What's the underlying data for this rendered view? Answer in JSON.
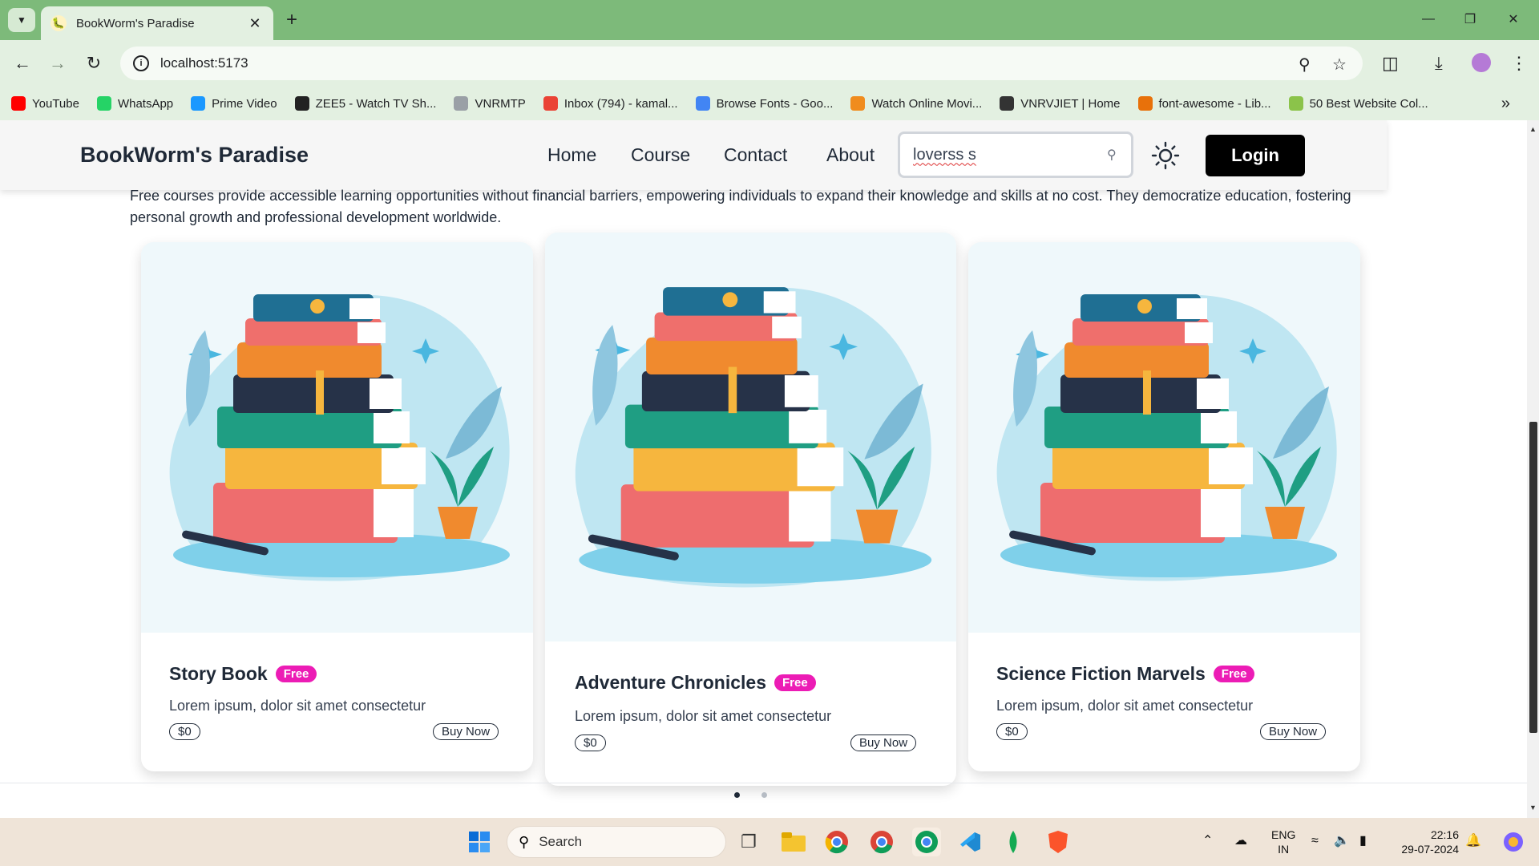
{
  "browser": {
    "tab_title": "BookWorm's Paradise",
    "url": "localhost:5173",
    "bookmarks": [
      {
        "label": "YouTube",
        "color": "#ff0000"
      },
      {
        "label": "WhatsApp",
        "color": "#25d366"
      },
      {
        "label": "Prime Video",
        "color": "#1a98ff"
      },
      {
        "label": "ZEE5 - Watch TV Sh...",
        "color": "#222222"
      },
      {
        "label": "VNRMTP",
        "color": "#9aa0a6"
      },
      {
        "label": "Inbox (794) - kamal...",
        "color": "#ea4335"
      },
      {
        "label": "Browse Fonts - Goo...",
        "color": "#4285f4"
      },
      {
        "label": "Watch Online Movi...",
        "color": "#f08c1e"
      },
      {
        "label": "VNRVJIET | Home",
        "color": "#333333"
      },
      {
        "label": "font-awesome - Lib...",
        "color": "#e8710a"
      },
      {
        "label": "50 Best Website Col...",
        "color": "#8bc34a"
      }
    ]
  },
  "site": {
    "brand": "BookWorm's Paradise",
    "nav": [
      "Home",
      "Course",
      "Contact",
      "About"
    ],
    "search_value": "loverss s",
    "login_label": "Login",
    "intro": "Free courses provide accessible learning opportunities without financial barriers, empowering individuals to expand their knowledge and skills at no cost. They democratize education, fostering personal growth and professional development worldwide."
  },
  "cards": [
    {
      "title": "Story Book",
      "badge": "Free",
      "desc": "Lorem ipsum, dolor sit amet consectetur",
      "price": "$0",
      "button": "Buy Now"
    },
    {
      "title": "Adventure Chronicles",
      "badge": "Free",
      "desc": "Lorem ipsum, dolor sit amet consectetur",
      "price": "$0",
      "button": "Buy Now"
    },
    {
      "title": "Science Fiction Marvels",
      "badge": "Free",
      "desc": "Lorem ipsum, dolor sit amet consectetur",
      "price": "$0",
      "button": "Buy Now"
    }
  ],
  "carousel": {
    "pages": 2,
    "active": 1
  },
  "taskbar": {
    "search_label": "Search",
    "language": "ENG",
    "region": "IN",
    "time": "22:16",
    "date": "29-07-2024"
  },
  "colors": {
    "badge": "#ec1cb5",
    "browser_frame": "#7dba7a",
    "taskbar": "#efe4d8"
  }
}
